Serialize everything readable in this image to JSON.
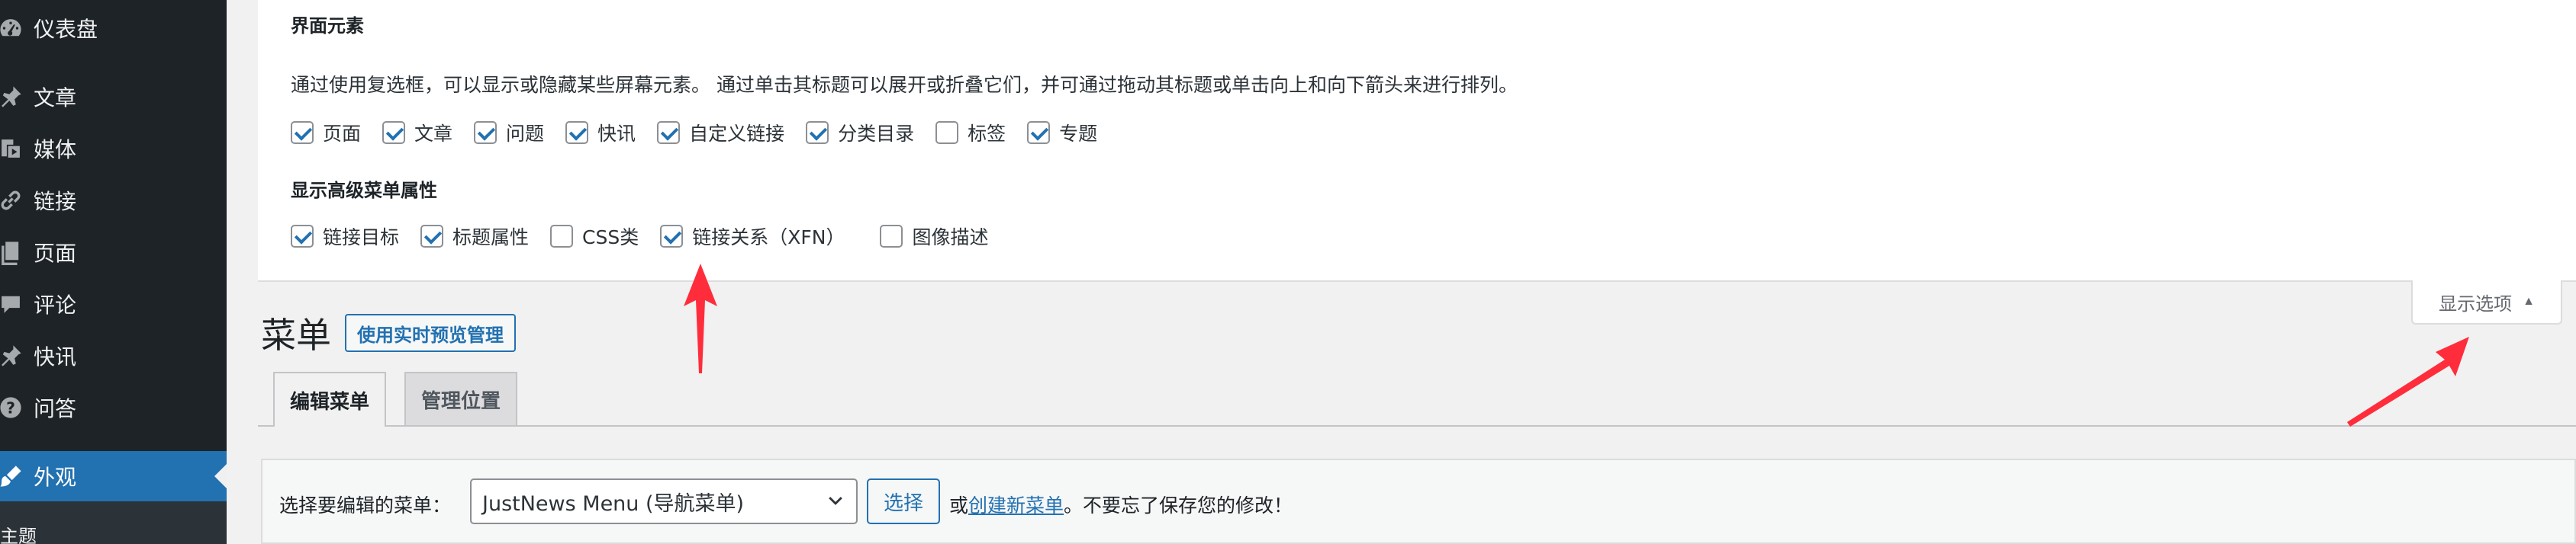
{
  "sidebar": {
    "items": [
      {
        "label": "仪表盘",
        "icon": "dashboard-icon"
      },
      {
        "label": "文章",
        "icon": "pushpin-icon"
      },
      {
        "label": "媒体",
        "icon": "media-icon"
      },
      {
        "label": "链接",
        "icon": "link-icon"
      },
      {
        "label": "页面",
        "icon": "page-icon"
      },
      {
        "label": "评论",
        "icon": "comment-icon"
      },
      {
        "label": "快讯",
        "icon": "pushpin-icon"
      },
      {
        "label": "问答",
        "icon": "help-icon"
      },
      {
        "label": "外观",
        "icon": "appearance-brush-icon",
        "active": true
      }
    ],
    "submenu_first": "主题"
  },
  "screen_options": {
    "section1_title": "界面元素",
    "description": "通过使用复选框，可以显示或隐藏某些屏幕元素。 通过单击其标题可以展开或折叠它们，并可通过拖动其标题或单击向上和向下箭头来进行排列。",
    "boxes": [
      {
        "label": "页面",
        "checked": true
      },
      {
        "label": "文章",
        "checked": true
      },
      {
        "label": "问题",
        "checked": true
      },
      {
        "label": "快讯",
        "checked": true
      },
      {
        "label": "自定义链接",
        "checked": true
      },
      {
        "label": "分类目录",
        "checked": true
      },
      {
        "label": "标签",
        "checked": false
      },
      {
        "label": "专题",
        "checked": true
      }
    ],
    "section2_title": "显示高级菜单属性",
    "advanced": [
      {
        "label": "链接目标",
        "checked": true
      },
      {
        "label": "标题属性",
        "checked": true
      },
      {
        "label": "CSS类",
        "checked": false
      },
      {
        "label": "链接关系（XFN）",
        "checked": true
      },
      {
        "label": "图像描述",
        "checked": false
      }
    ],
    "toggle_label": "显示选项"
  },
  "page": {
    "title": "菜单",
    "live_preview_button": "使用实时预览管理"
  },
  "tabs": [
    {
      "label": "编辑菜单",
      "active": true
    },
    {
      "label": "管理位置",
      "active": false
    }
  ],
  "menu_select": {
    "label": "选择要编辑的菜单：",
    "selected": "JustNews Menu (导航菜单)",
    "select_button": "选择",
    "help_prefix": "或",
    "create_link": "创建新菜单",
    "help_suffix": "。不要忘了保存您的修改！"
  },
  "colors": {
    "sidebar_bg": "#1d2327",
    "accent": "#2271b1",
    "annotation_arrow": "#ff2d3b"
  }
}
